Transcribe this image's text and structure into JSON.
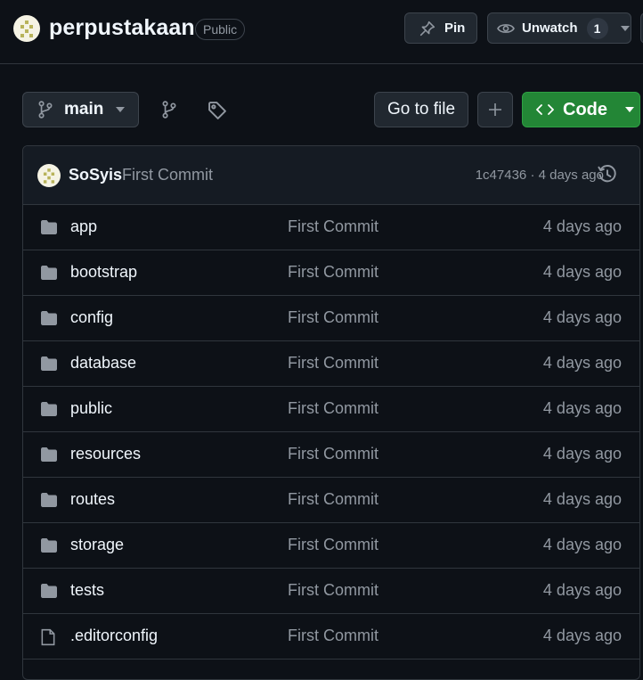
{
  "header": {
    "repo_name": "perpustakaan",
    "visibility": "Public",
    "pin_label": "Pin",
    "watch_label": "Unwatch",
    "watch_count": "1"
  },
  "toolbar": {
    "branch": "main",
    "goto_file_label": "Go to file",
    "code_label": "Code"
  },
  "latest_commit": {
    "author": "SoSyis",
    "message": "First Commit",
    "meta": "1c47436 · 4 days ago"
  },
  "files": [
    {
      "name": "app",
      "type": "folder",
      "commit": "First Commit",
      "date": "4 days ago"
    },
    {
      "name": "bootstrap",
      "type": "folder",
      "commit": "First Commit",
      "date": "4 days ago"
    },
    {
      "name": "config",
      "type": "folder",
      "commit": "First Commit",
      "date": "4 days ago"
    },
    {
      "name": "database",
      "type": "folder",
      "commit": "First Commit",
      "date": "4 days ago"
    },
    {
      "name": "public",
      "type": "folder",
      "commit": "First Commit",
      "date": "4 days ago"
    },
    {
      "name": "resources",
      "type": "folder",
      "commit": "First Commit",
      "date": "4 days ago"
    },
    {
      "name": "routes",
      "type": "folder",
      "commit": "First Commit",
      "date": "4 days ago"
    },
    {
      "name": "storage",
      "type": "folder",
      "commit": "First Commit",
      "date": "4 days ago"
    },
    {
      "name": "tests",
      "type": "folder",
      "commit": "First Commit",
      "date": "4 days ago"
    },
    {
      "name": ".editorconfig",
      "type": "file",
      "commit": "First Commit",
      "date": "4 days ago"
    }
  ],
  "colors": {
    "background": "#0d1117",
    "code_button": "#238636",
    "border": "#30363d",
    "muted_text": "#9198a1"
  }
}
